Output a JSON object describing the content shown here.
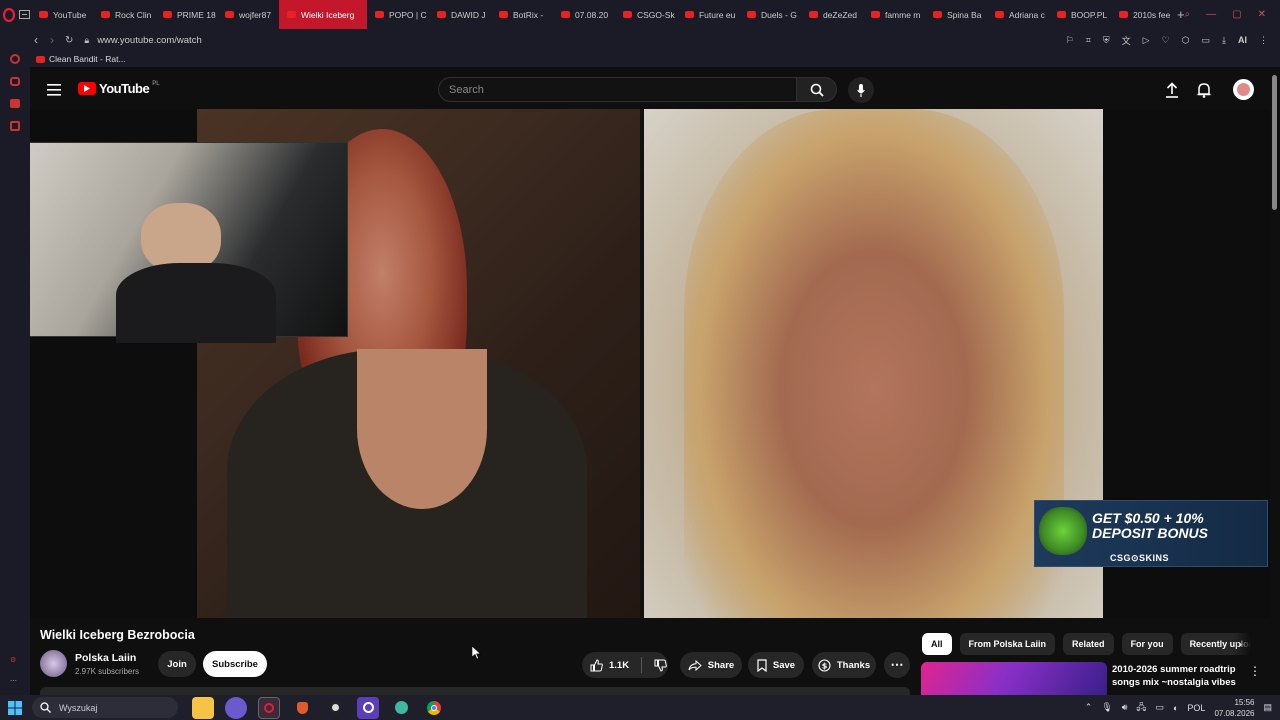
{
  "browser": {
    "tabs": [
      {
        "label": "YouTube",
        "active": false
      },
      {
        "label": "Rock Clin",
        "active": false
      },
      {
        "label": "PRIME 18",
        "active": false
      },
      {
        "label": "wojfer87",
        "active": false
      },
      {
        "label": "Wielki Iceberg",
        "active": true
      },
      {
        "label": "POPO | C",
        "active": false
      },
      {
        "label": "DAWID J",
        "active": false
      },
      {
        "label": "BotRix -",
        "active": false
      },
      {
        "label": "07.08.20",
        "active": false
      },
      {
        "label": "CSGO-Sk",
        "active": false
      },
      {
        "label": "Future eu",
        "active": false
      },
      {
        "label": "Duels - G",
        "active": false
      },
      {
        "label": "deZeZed",
        "active": false
      },
      {
        "label": "famme m",
        "active": false
      },
      {
        "label": "Spina Ba",
        "active": false
      },
      {
        "label": "Adriana c",
        "active": false
      },
      {
        "label": "BOOP.PL",
        "active": false
      },
      {
        "label": "2010s fee",
        "active": false
      }
    ],
    "url": "www.youtube.com/watch",
    "bookmark": "Clean Bandit - Rat...",
    "ai_label": "AI"
  },
  "youtube": {
    "logo_text": "YouTube",
    "region": "PL",
    "search_placeholder": "Search",
    "video_title": "Wielki Iceberg Bezrobocia",
    "channel": {
      "name": "Polska Laiin",
      "subscribers": "2.97K subscribers"
    },
    "join_label": "Join",
    "subscribe_label": "Subscribe",
    "like_count": "1.1K",
    "share_label": "Share",
    "save_label": "Save",
    "thanks_label": "Thanks",
    "chips": [
      "All",
      "From Polska Laiin",
      "Related",
      "For you",
      "Recently uploa"
    ],
    "recommended": {
      "title_line1": "2010-2026 summer roadtrip",
      "title_line2": "songs mix ~nostalgia vibes ..."
    },
    "ad": {
      "line1": "GET $0.50 + 10%",
      "line2": "DEPOSIT BONUS",
      "brand": "CSG⊙SKINS"
    }
  },
  "taskbar": {
    "search_placeholder": "Wyszukaj",
    "lang": "POL",
    "time": "15:56",
    "date": "07.08.2026"
  },
  "colors": {
    "accent_red": "#ff0000",
    "tab_active": "#c4172c",
    "ad_yellow": "#f7c619"
  }
}
